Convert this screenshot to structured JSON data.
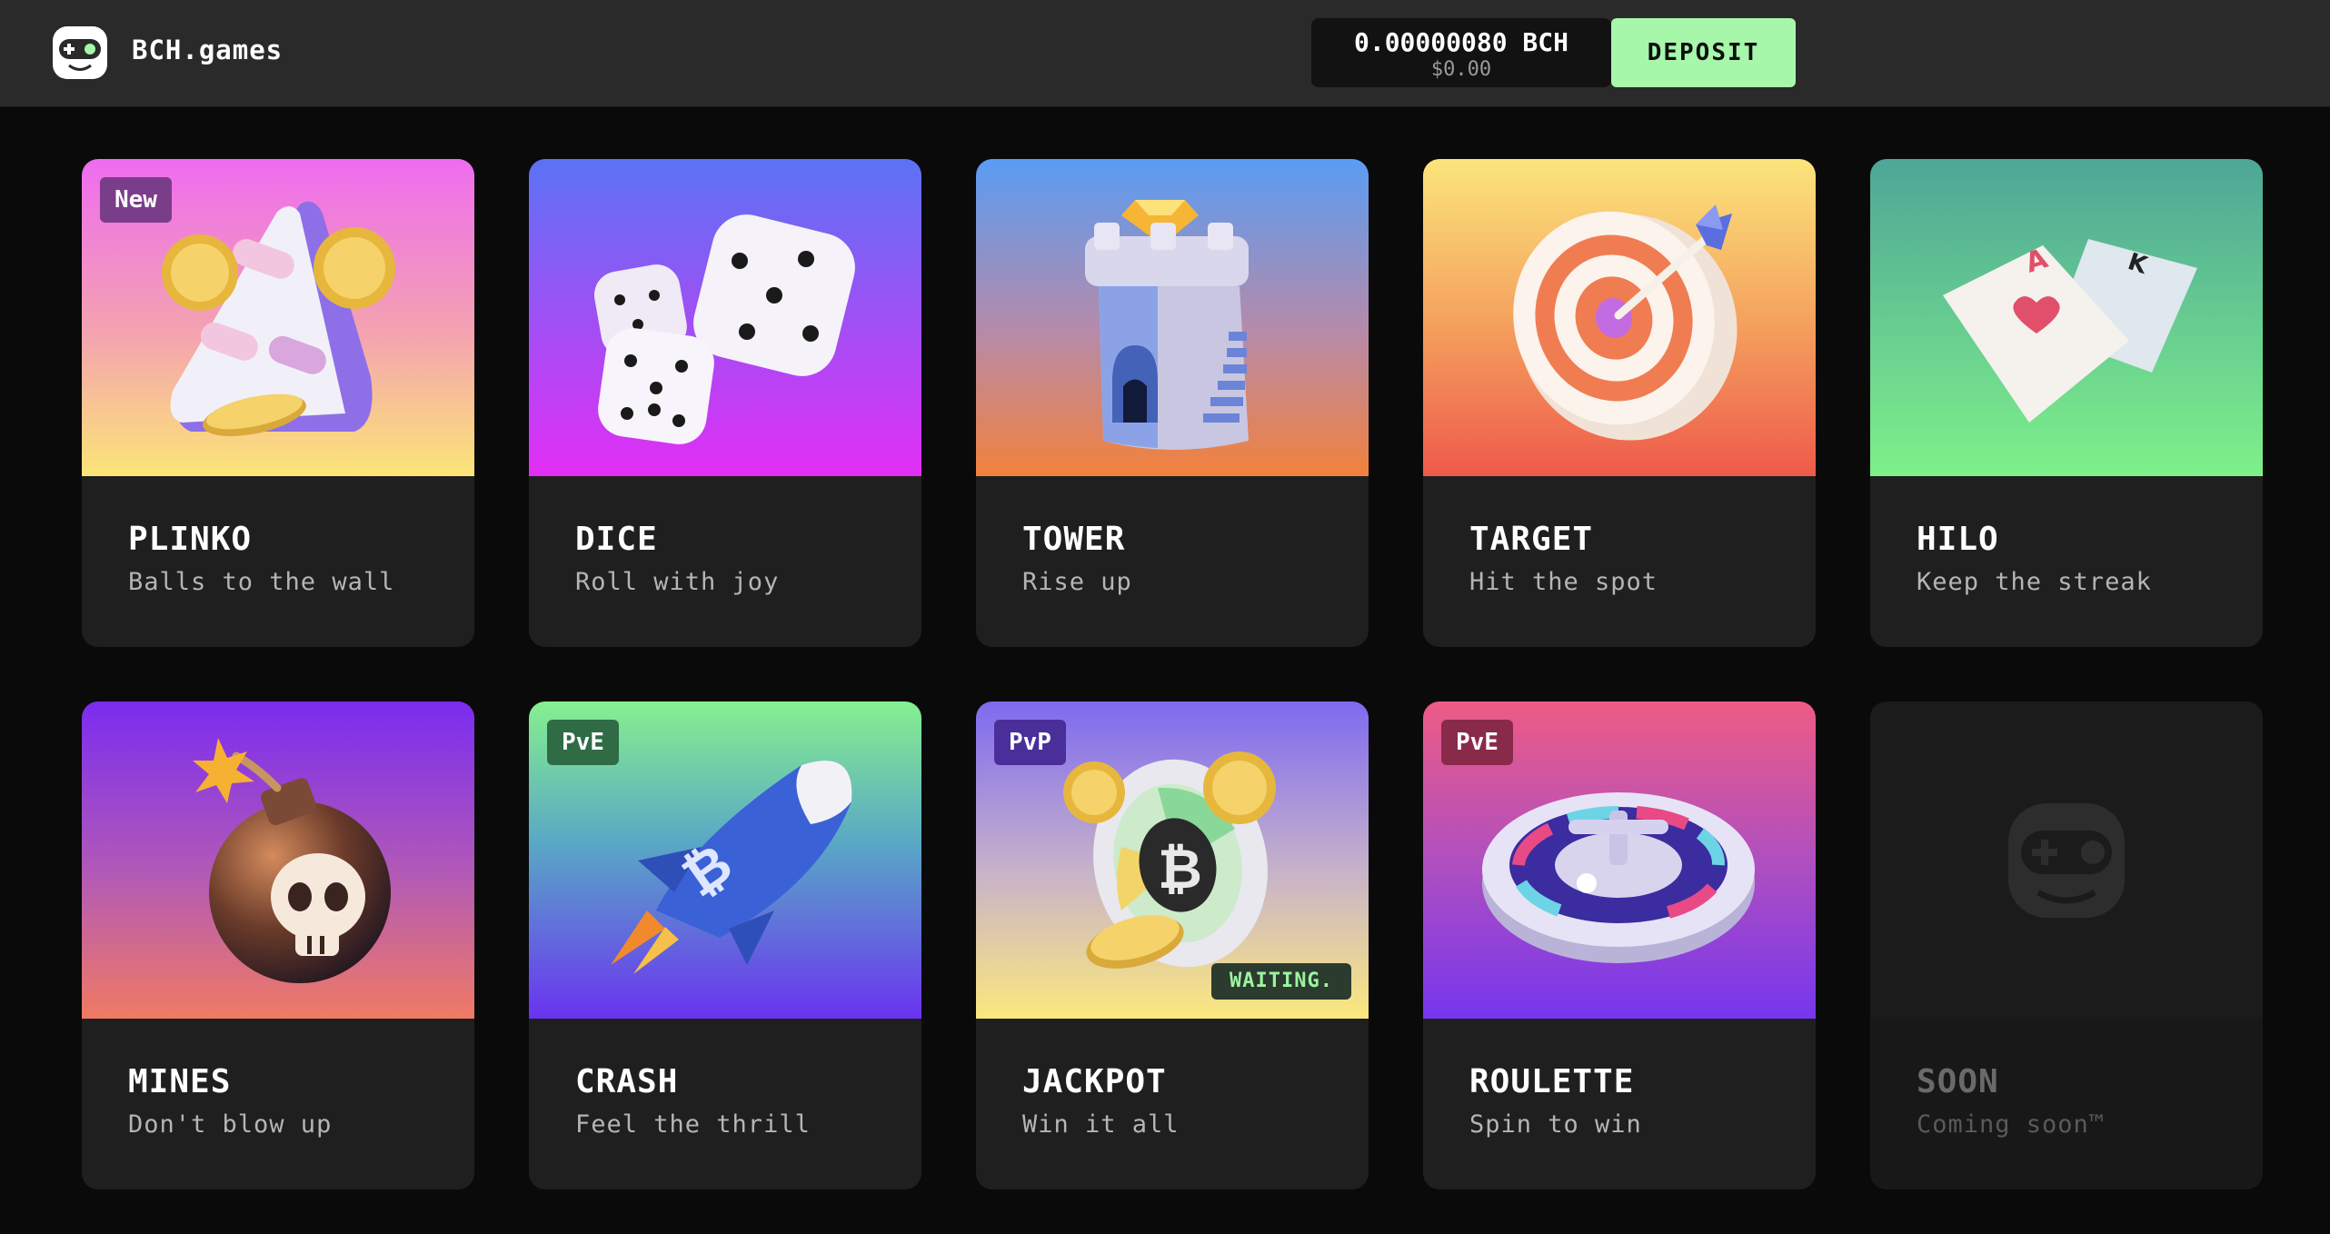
{
  "header": {
    "brand": "BCH.games",
    "balance": "0.00000080 BCH",
    "balance_usd": "$0.00",
    "deposit_label": "DEPOSIT"
  },
  "games": [
    {
      "title": "PLINKO",
      "subtitle": "Balls to the wall",
      "badge": "New"
    },
    {
      "title": "DICE",
      "subtitle": "Roll with joy"
    },
    {
      "title": "TOWER",
      "subtitle": "Rise up"
    },
    {
      "title": "TARGET",
      "subtitle": "Hit the spot"
    },
    {
      "title": "HILO",
      "subtitle": "Keep the streak"
    },
    {
      "title": "MINES",
      "subtitle": "Don't blow up"
    },
    {
      "title": "CRASH",
      "subtitle": "Feel the thrill",
      "badge": "PvE"
    },
    {
      "title": "JACKPOT",
      "subtitle": "Win it all",
      "badge": "PvP",
      "status": "WAITING."
    },
    {
      "title": "ROULETTE",
      "subtitle": "Spin to win",
      "badge": "PvE"
    },
    {
      "title": "SOON",
      "subtitle": "Coming soon™"
    }
  ],
  "colors": {
    "background": "#0a0a0a",
    "topbar": "#2a2a2a",
    "card": "#1f1f1f",
    "deposit": "#a6f7a9"
  },
  "icons": [
    "bch-games-logo-icon",
    "plinko-icon",
    "dice-icon",
    "tower-icon",
    "target-icon",
    "cards-icon",
    "bomb-icon",
    "rocket-icon",
    "jackpot-wheel-icon",
    "roulette-icon",
    "gamepad-placeholder-icon"
  ]
}
